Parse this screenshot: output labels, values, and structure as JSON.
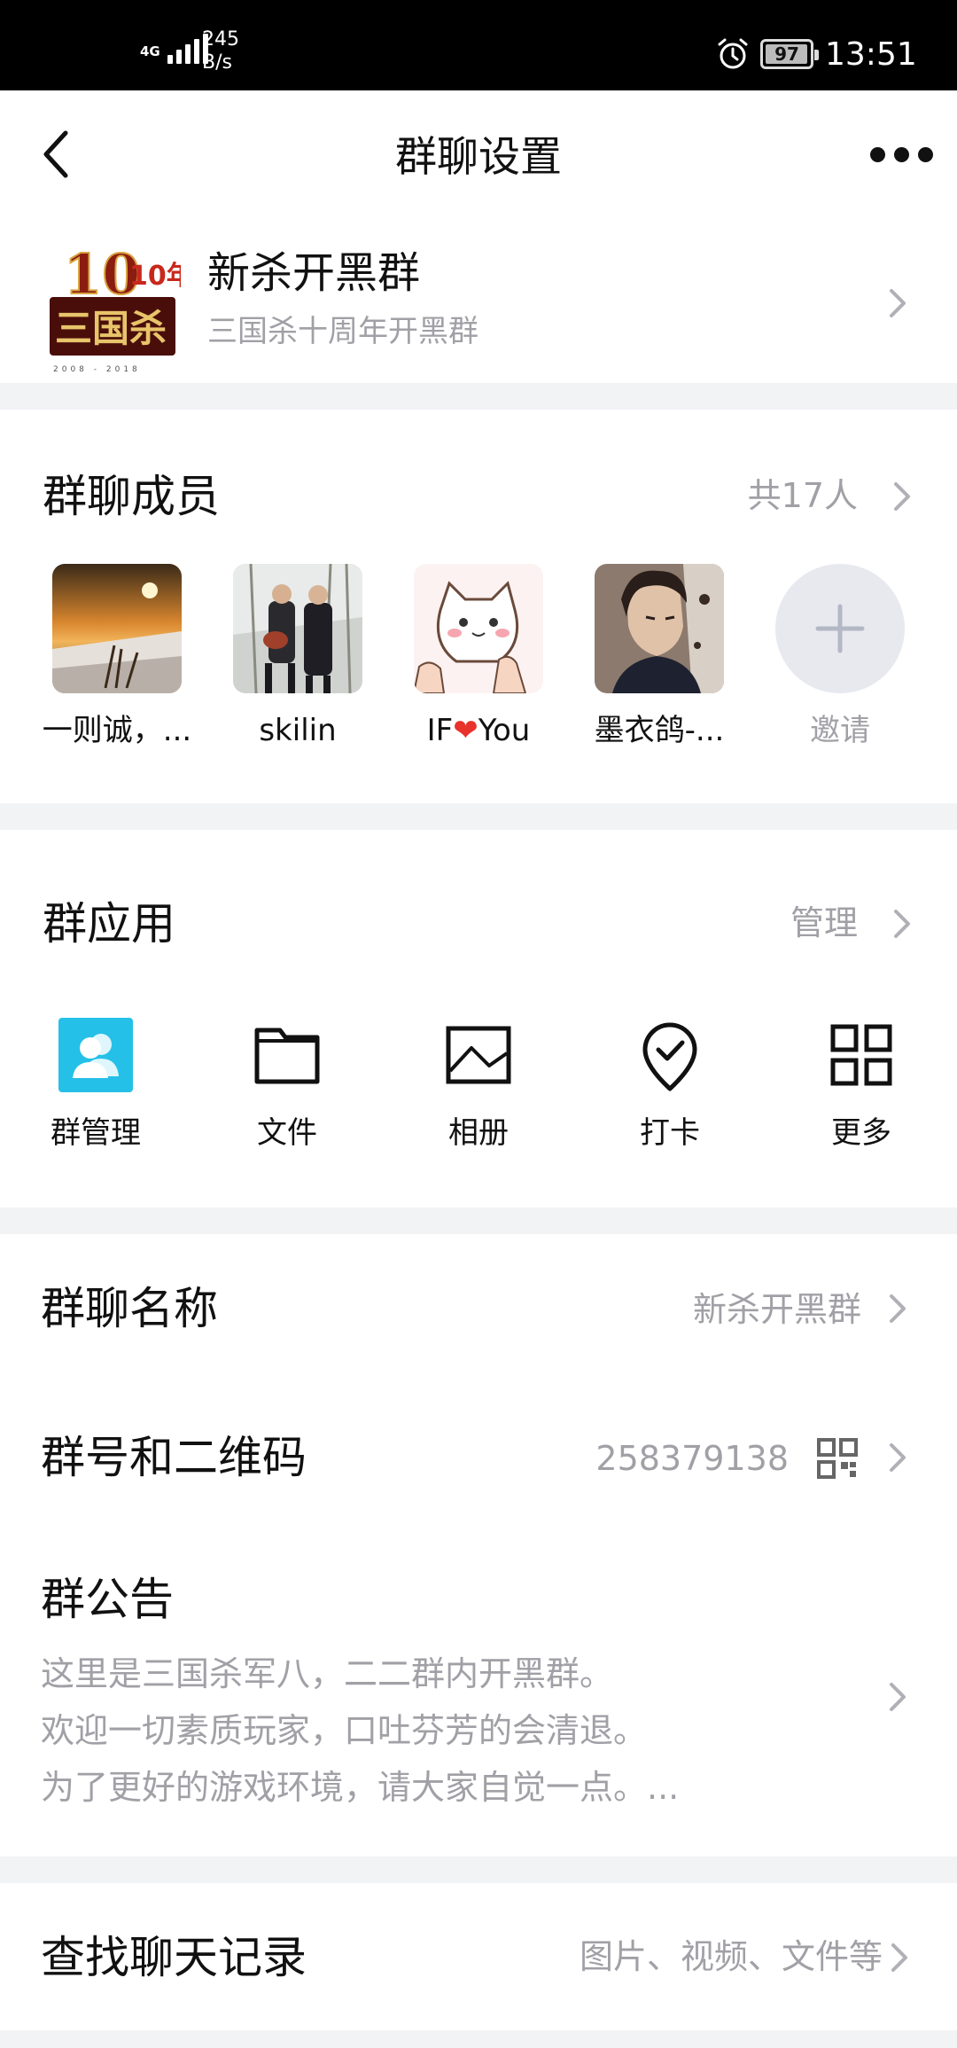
{
  "status_bar": {
    "network": "4G",
    "speed_value": "245",
    "speed_unit": "B/s",
    "battery": "97",
    "time": "13:51"
  },
  "nav": {
    "title": "群聊设置",
    "back_icon": "chevron-left-icon",
    "more_icon": "more-dots-icon"
  },
  "group": {
    "name": "新杀开黑群",
    "description": "三国杀十周年开黑群",
    "avatar_text": "三国杀",
    "avatar_badge": "10年",
    "avatar_years": "2008 - 2018"
  },
  "members": {
    "title": "群聊成员",
    "count_label": "共17人",
    "list": [
      {
        "name": "一则诚，..."
      },
      {
        "name": "skilin"
      },
      {
        "name": "IF",
        "heart": "❤",
        "name_suffix": "You"
      },
      {
        "name": "墨衣鸽-..."
      }
    ],
    "invite_label": "邀请"
  },
  "apps": {
    "title": "群应用",
    "manage_label": "管理",
    "items": [
      {
        "label": "群管理",
        "icon": "group-admin-icon"
      },
      {
        "label": "文件",
        "icon": "folder-icon"
      },
      {
        "label": "相册",
        "icon": "photo-album-icon"
      },
      {
        "label": "打卡",
        "icon": "checkin-icon"
      },
      {
        "label": "更多",
        "icon": "grid-more-icon"
      }
    ]
  },
  "settings": {
    "group_name_label": "群聊名称",
    "group_name_value": "新杀开黑群",
    "group_id_label": "群号和二维码",
    "group_id_value": "258379138",
    "notice_label": "群公告",
    "notice_lines": [
      "这里是三国杀军八，二二群内开黑群。",
      "欢迎一切素质玩家，口吐芬芳的会清退。",
      "为了更好的游戏环境，请大家自觉一点。..."
    ]
  },
  "search": {
    "label": "查找聊天记录",
    "hint": "图片、视频、文件等"
  },
  "colors": {
    "accent": "#24c0e8",
    "secondary_text": "#a0a0a6",
    "divider_bg": "#f2f3f5",
    "heart": "#e8322c"
  }
}
